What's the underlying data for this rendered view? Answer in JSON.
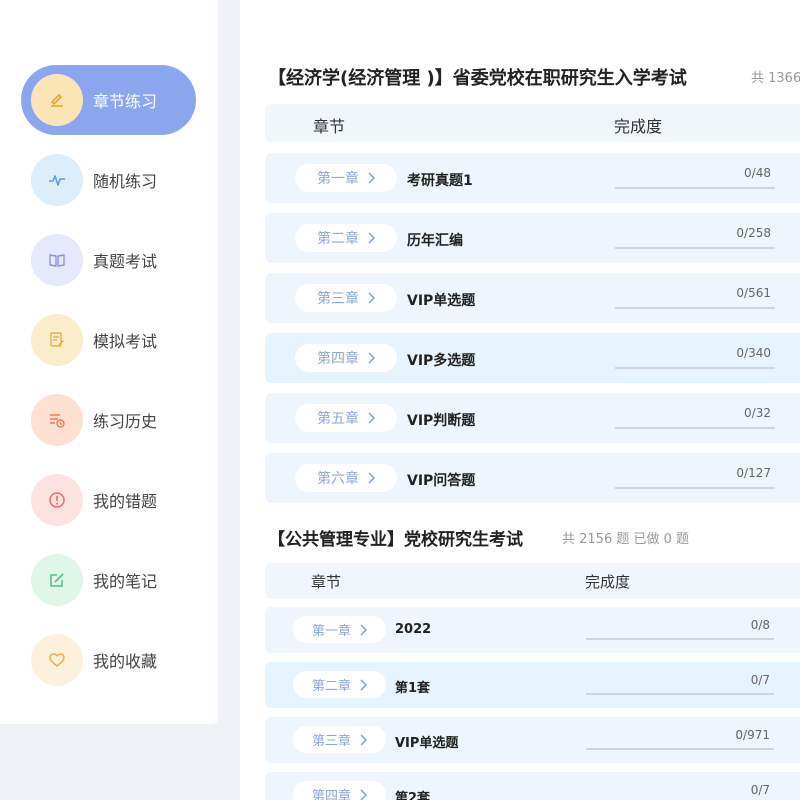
{
  "sidebar": {
    "items": [
      {
        "label": "章节练习",
        "icon": "pencil-icon",
        "active": true
      },
      {
        "label": "随机练习",
        "icon": "pulse-icon"
      },
      {
        "label": "真题考试",
        "icon": "book-icon"
      },
      {
        "label": "模拟考试",
        "icon": "edit-note-icon"
      },
      {
        "label": "练习历史",
        "icon": "history-list-icon"
      },
      {
        "label": "我的错题",
        "icon": "warning-icon"
      },
      {
        "label": "我的笔记",
        "icon": "edit-box-icon"
      },
      {
        "label": "我的收藏",
        "icon": "heart-icon"
      }
    ]
  },
  "sections": [
    {
      "title": "【经济学(经济管理 )】省委党校在职研究生入学考试",
      "count_text": "共 1366",
      "col_chapter": "章节",
      "col_progress": "完成度",
      "rows": [
        {
          "chapter": "第一章",
          "title": "考研真题1",
          "progress": "0/48"
        },
        {
          "chapter": "第二章",
          "title": "历年汇编",
          "progress": "0/258"
        },
        {
          "chapter": "第三章",
          "title": "VIP单选题",
          "progress": "0/561"
        },
        {
          "chapter": "第四章",
          "title": "VIP多选题",
          "progress": "0/340"
        },
        {
          "chapter": "第五章",
          "title": "VIP判断题",
          "progress": "0/32"
        },
        {
          "chapter": "第六章",
          "title": "VIP问答题",
          "progress": "0/127"
        }
      ]
    },
    {
      "title": "【公共管理专业】党校研究生考试",
      "count_text": "共 2156 题 已做 0 题",
      "col_chapter": "章节",
      "col_progress": "完成度",
      "rows": [
        {
          "chapter": "第一章",
          "title": "2022",
          "progress": "0/8"
        },
        {
          "chapter": "第二章",
          "title": "第1套",
          "progress": "0/7"
        },
        {
          "chapter": "第三章",
          "title": "VIP单选题",
          "progress": "0/971"
        },
        {
          "chapter": "第四章",
          "title": "第2套",
          "progress": "0/7"
        }
      ]
    }
  ],
  "colors": {
    "accent": "#8ba6ee",
    "chip_text": "#8fa7d6",
    "row_bg": "#eef5fc",
    "row_highlight": "#e6f5fd"
  }
}
